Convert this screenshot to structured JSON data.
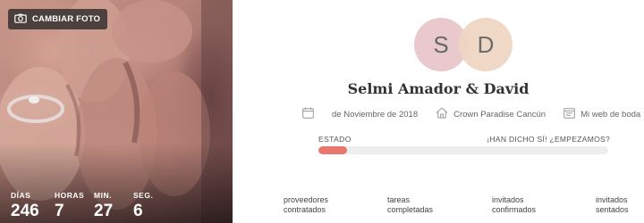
{
  "photo": {
    "change_label": "CAMBIAR FOTO"
  },
  "countdown": {
    "dias_label": "DÍAS",
    "dias": "246",
    "horas_label": "HORAS",
    "horas": "7",
    "min_label": "MIN.",
    "min": "27",
    "seg_label": "SEG.",
    "seg": "6"
  },
  "couple": {
    "initial_1": "S",
    "initial_2": "D",
    "name": "Selmi Amador & David"
  },
  "info": {
    "date": "de Noviembre de 2018",
    "venue": "Crown Paradise Cancún",
    "website": "Mi web de boda"
  },
  "status": {
    "label": "ESTADO",
    "message": "¡HAN DICHO SÍ! ¿EMPEZAMOS?",
    "progress": 0.1
  },
  "stats": {
    "vendors_line1": "proveedores",
    "vendors_line2": "contratados",
    "tasks_line1": "tareas",
    "tasks_line2": "completadas",
    "guests_line1": "invitados",
    "guests_line2": "confirmados",
    "seated_line1": "invitados",
    "seated_line2": "sentados"
  },
  "colors": {
    "progress_fill": "#e9776d",
    "avatar_1": "#e9c9cc",
    "avatar_2": "#efd6c3"
  }
}
